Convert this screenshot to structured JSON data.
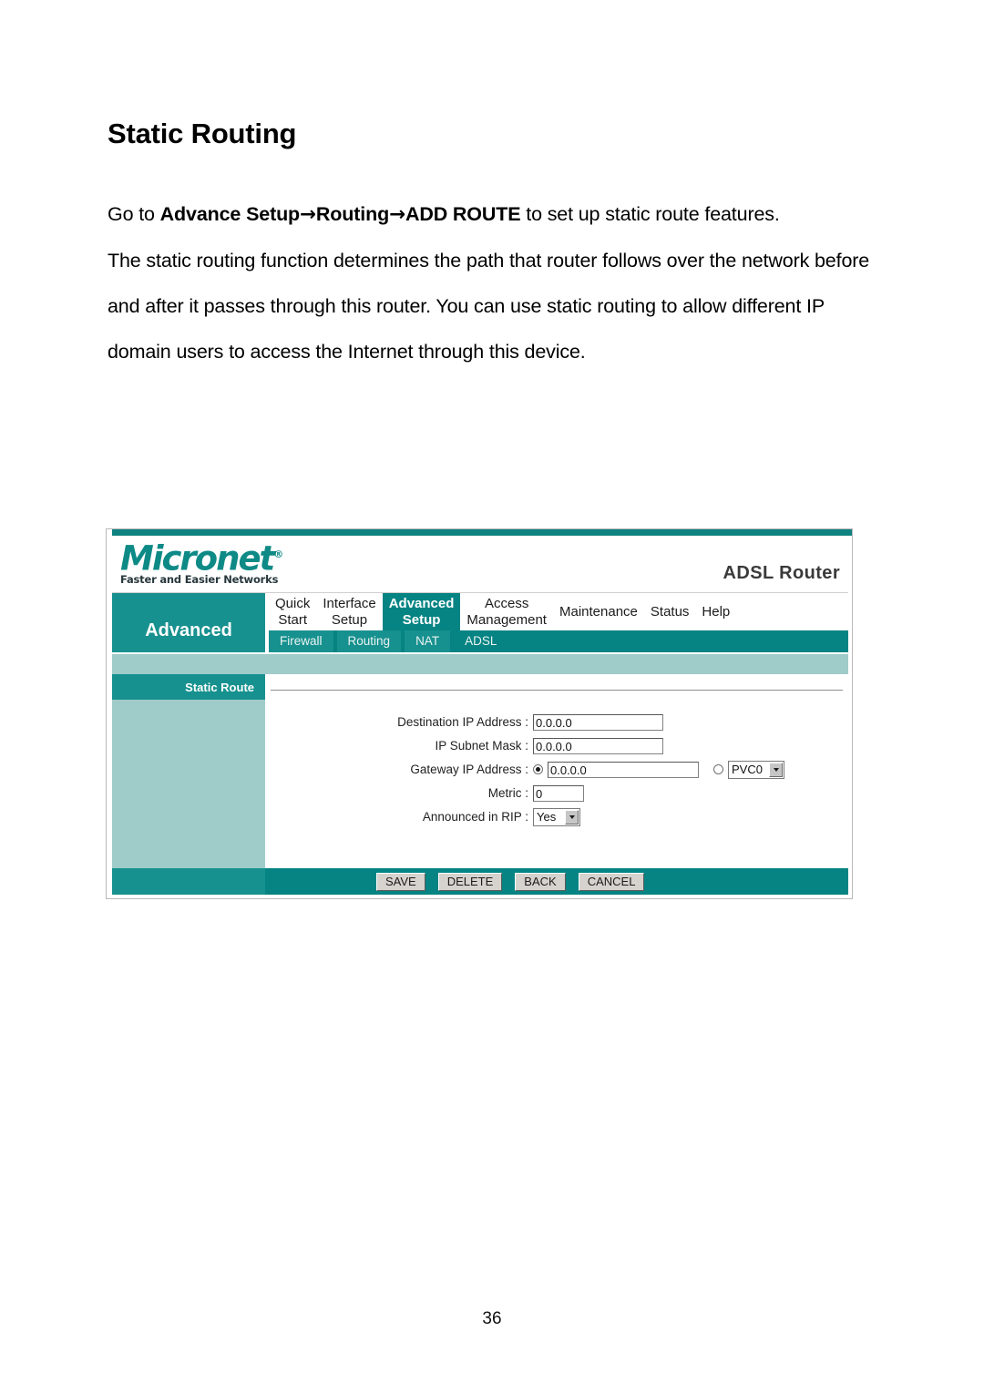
{
  "document": {
    "heading": "Static Routing",
    "intro": {
      "prefix": "Go to ",
      "bold1": "Advance Setup",
      "arrow1": "→",
      "bold2": "Routing",
      "arrow2": "→",
      "bold3": "ADD ROUTE",
      "suffix": " to set up static route features."
    },
    "paragraph": "The static routing function determines the path that router follows over the network before and after it passes through this router. You can use static routing to allow different IP domain users to access the Internet through this device.",
    "page_number": "36"
  },
  "router_ui": {
    "brand": {
      "name": "Micronet",
      "registered": "®",
      "tagline": "Faster and Easier Networks",
      "model": "ADSL Router"
    },
    "section_label": "Advanced",
    "top_tabs": [
      {
        "label": "Quick\nStart",
        "active": false
      },
      {
        "label": "Interface\nSetup",
        "active": false
      },
      {
        "label": "Advanced\nSetup",
        "active": true
      },
      {
        "label": "Access\nManagement",
        "active": false
      },
      {
        "label": "Maintenance",
        "active": false,
        "single": true
      },
      {
        "label": "Status",
        "active": false,
        "single": true
      },
      {
        "label": "Help",
        "active": false,
        "single": true
      }
    ],
    "sub_tabs": [
      {
        "label": "Firewall",
        "active": true
      },
      {
        "label": "Routing",
        "active": true
      },
      {
        "label": "NAT",
        "active": true
      },
      {
        "label": "ADSL",
        "active": false
      }
    ],
    "sidebar_item": "Static Route",
    "form": {
      "destination_ip": {
        "label": "Destination IP Address :",
        "value": "0.0.0.0"
      },
      "subnet_mask": {
        "label": "IP Subnet Mask :",
        "value": "0.0.0.0"
      },
      "gateway": {
        "label": "Gateway IP Address :",
        "value": "0.0.0.0",
        "radio_ip_selected": true,
        "radio_pvc_selected": false,
        "pvc_value": "PVC0"
      },
      "metric": {
        "label": "Metric :",
        "value": "0"
      },
      "announced_in_rip": {
        "label": "Announced in RIP :",
        "value": "Yes"
      }
    },
    "buttons": [
      {
        "label": "SAVE"
      },
      {
        "label": "DELETE"
      },
      {
        "label": "BACK"
      },
      {
        "label": "CANCEL"
      }
    ],
    "colors": {
      "teal_dark": "#058483",
      "teal_mid": "#17918f",
      "teal_light": "#9fcbc9",
      "logo_teal": "#0e8a86"
    }
  }
}
